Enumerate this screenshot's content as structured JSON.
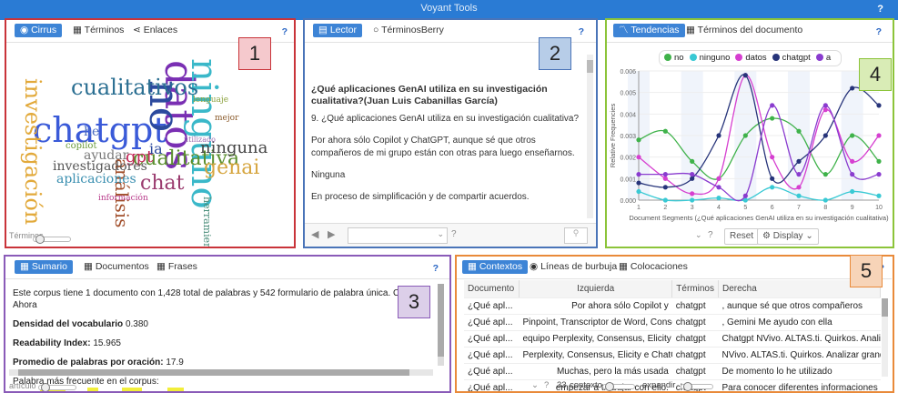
{
  "app": {
    "title": "Voyant Tools",
    "help": "?"
  },
  "annotations": [
    "1",
    "2",
    "3",
    "4",
    "5"
  ],
  "panel1": {
    "tabs": [
      "Cirrus",
      "Términos",
      "Enlaces"
    ],
    "help": "?",
    "footer_label": "Términos",
    "words": [
      {
        "text": "chatgpt",
        "color": "#3a5ad8"
      },
      {
        "text": "datos",
        "color": "#7a2fb3"
      },
      {
        "text": "ninguno",
        "color": "#3ab8c9"
      },
      {
        "text": "no",
        "color": "#2c4a9e"
      },
      {
        "text": "investigación",
        "color": "#e2a93a"
      },
      {
        "text": "cualitativos",
        "color": "#2b6f92"
      },
      {
        "text": "cualitativa",
        "color": "#5a8f2e"
      },
      {
        "text": "ninguna",
        "color": "#444444"
      },
      {
        "text": "genai",
        "color": "#d6a640"
      },
      {
        "text": "gpt",
        "color": "#c42a59"
      },
      {
        "text": "ia",
        "color": "#2c4a9e"
      },
      {
        "text": "chat",
        "color": "#9a3a6e"
      },
      {
        "text": "análisis",
        "color": "#a14e2a"
      },
      {
        "text": "herramientas",
        "color": "#4a8d7a"
      },
      {
        "text": "investigadores",
        "color": "#555555"
      },
      {
        "text": "aplicaciones",
        "color": "#3a8fb0"
      },
      {
        "text": "ayudar",
        "color": "#777777"
      },
      {
        "text": "utilizado",
        "color": "#9b6bb0"
      },
      {
        "text": "he",
        "color": "#4a6bc0"
      },
      {
        "text": "copilot",
        "color": "#6a9a3a"
      },
      {
        "text": "mejor",
        "color": "#8a5a2a"
      },
      {
        "text": "información",
        "color": "#b83a8a"
      },
      {
        "text": "lenguaje",
        "color": "#8aa03a"
      }
    ]
  },
  "panel2": {
    "tabs": [
      "Lector",
      "TérminosBerry"
    ],
    "help": "?",
    "heading": "¿Qué aplicaciones GenAI utiliza en su investigación cualitativa?(Juan Luis Cabanillas García)",
    "paragraphs": [
      "9. ¿Qué aplicaciones GenAI utiliza en su investigación cualitativa?",
      "Por ahora sólo Copilot y ChatGPT, aunque sé que otros compañeros de mi grupo están con otras para luego enseñarnos.",
      "Ninguna",
      "En proceso de simplificación y de compartir acuerdos."
    ],
    "footer_help": "?"
  },
  "panel3": {
    "tabs": [
      "Sumario",
      "Documentos",
      "Frases"
    ],
    "help": "?",
    "summary": "Este corpus tiene 1 documento con 1,428 total de palabras y 542 formulario de palabra única. Creado Ahora",
    "density_label": "Densidad del vocabulario",
    "density_value": "0.380",
    "readability_label": "Readability Index:",
    "readability_value": "15.965",
    "avg_label": "Promedio de palabras por oración:",
    "avg_value": "17.9",
    "frequent_label": "Palabra más frecuente en el corpus:",
    "footer_label": "artículo"
  },
  "panel4": {
    "tabs": [
      "Tendencias",
      "Términos del documento"
    ],
    "help": "?",
    "footer_help": "?",
    "reset_label": "Reset",
    "display_label": "Display"
  },
  "panel5": {
    "tabs": [
      "Contextos",
      "Líneas de burbuja",
      "Colocaciones"
    ],
    "help": "?",
    "columns": [
      "Documento",
      "Izquierda",
      "Términos",
      "Derecha"
    ],
    "rows": [
      [
        "¿Qué apl...",
        "Por ahora sólo Copilot y",
        "chatgpt",
        ", aunque sé que otros compañeros"
      ],
      [
        "¿Qué apl...",
        "Pinpoint, Transcriptor de Word, Consensus,",
        "chatgpt",
        ", Gemini Me ayudo con ella"
      ],
      [
        "¿Qué apl...",
        "equipo Perplexity, Consensus, Elicity e",
        "chatgpt",
        "Chatgpt NVivo. ALTAS.ti. Quirkos. Analizar"
      ],
      [
        "¿Qué apl...",
        "Perplexity, Consensus, Elicity e ChatGPT",
        "chatgpt",
        "NVivo. ALTAS.ti. Quirkos. Analizar grandes"
      ],
      [
        "¿Qué apl...",
        "Muchas, pero la más usada",
        "chatgpt",
        "De momento lo he utilizado"
      ],
      [
        "¿Qué apl...",
        "empezar a trabajar con ello.",
        "chatgpt",
        "Para conocer diferentes informaciones Ch..."
      ]
    ],
    "footer_help": "?",
    "context_count": "33",
    "context_label": "contexto",
    "expand_label": "expandir"
  },
  "chart_data": {
    "type": "line",
    "title": "",
    "xlabel": "Document Segments (¿Qué aplicaciones GenAI utiliza en su investigación cualitativa)",
    "ylabel": "Relative Frequencies",
    "x": [
      1,
      2,
      3,
      4,
      5,
      6,
      7,
      8,
      9,
      10
    ],
    "ylim": [
      0,
      0.006
    ],
    "yticks": [
      "0.000",
      "0.001",
      "0.002",
      "0.003",
      "0.004",
      "0.005",
      "0.006"
    ],
    "legend_position": "top",
    "series": [
      {
        "name": "no",
        "color": "#3fb24a",
        "values": [
          0.0028,
          0.0032,
          0.0018,
          0.001,
          0.003,
          0.0038,
          0.0032,
          0.0012,
          0.003,
          0.0018
        ]
      },
      {
        "name": "ninguno",
        "color": "#39c9d4",
        "values": [
          0.0004,
          0.0,
          0.0,
          0.0001,
          0.0,
          0.0006,
          0.0002,
          0.0,
          0.0004,
          0.0002
        ]
      },
      {
        "name": "datos",
        "color": "#d63fd0",
        "values": [
          0.002,
          0.001,
          0.0003,
          0.001,
          0.0058,
          0.002,
          0.0006,
          0.0042,
          0.0018,
          0.003
        ]
      },
      {
        "name": "chatgpt",
        "color": "#27347a",
        "values": [
          0.0008,
          0.0006,
          0.001,
          0.003,
          0.0058,
          0.001,
          0.0018,
          0.003,
          0.0052,
          0.0044
        ]
      },
      {
        "name": "a",
        "color": "#8a3ccf",
        "values": [
          0.0012,
          0.0012,
          0.0012,
          0.0006,
          0.0002,
          0.0044,
          0.0012,
          0.0044,
          0.0012,
          0.0012
        ]
      }
    ]
  }
}
